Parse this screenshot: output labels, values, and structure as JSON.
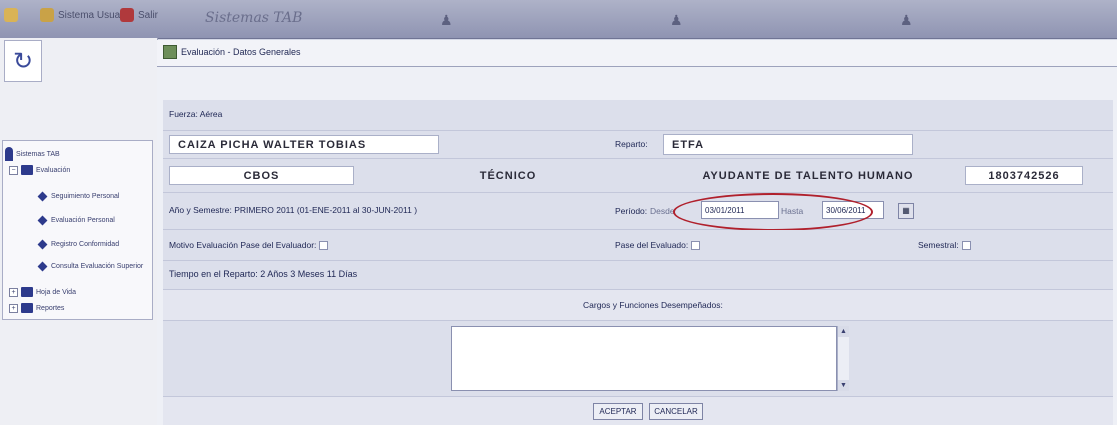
{
  "top_bar": {
    "app_name": "Sistemas TAB",
    "items": [
      {
        "label": "",
        "icon": "home-icon"
      },
      {
        "label": "Sistema Usuario",
        "icon": "user-icon"
      },
      {
        "label": "Salir",
        "icon": "exit-icon"
      }
    ]
  },
  "sidebar": {
    "refresh_icon": "refresh-icon",
    "tree": [
      {
        "label": "Sistemas TAB",
        "icon": "user-icon",
        "level": 0
      },
      {
        "label": "Evaluación",
        "icon": "folder-icon",
        "level": 1
      },
      {
        "label": "Seguimiento Personal",
        "icon": "diamond-icon",
        "level": 2
      },
      {
        "label": "Evaluación Personal",
        "icon": "diamond-icon",
        "level": 2
      },
      {
        "label": "Registro Conformidad",
        "icon": "diamond-icon",
        "level": 2
      },
      {
        "label": "Consulta Evaluación Superior",
        "icon": "diamond-icon",
        "level": 2
      },
      {
        "label": "Hoja de Vida",
        "icon": "folder-icon",
        "level": 1
      },
      {
        "label": "Reportes",
        "icon": "folder-icon",
        "level": 1
      }
    ]
  },
  "tab": {
    "label": "Evaluación - Datos Generales"
  },
  "form": {
    "section_label": "Fuerza: Aérea",
    "name": "CAIZA PICHA WALTER TOBIAS",
    "reparto_label": "Reparto:",
    "reparto_value": "ETFA",
    "grado": "CBOS",
    "especialidad": "TÉCNICO",
    "cargo": "AYUDANTE DE TALENTO HUMANO",
    "cedula": "1803742526",
    "semestre_text": "Año y Semestre: PRIMERO 2011 (01-ENE-2011 al 30-JUN-2011 )",
    "periodo_label": "Período:",
    "desde_label": "Desde",
    "desde_value": "03/01/2011",
    "hasta_label": "Hasta",
    "hasta_value": "30/06/2011",
    "motivo_label": "Motivo Evaluación Pase del Evaluador:",
    "pase_label": "Pase del Evaluado:",
    "semestral_label": "Semestral:",
    "tiempo_text": "Tiempo en el Reparto: 2 Años 3 Meses 11 Días",
    "cargos_label": "Cargos y Funciones Desempeñados:",
    "cargos_value": "",
    "accept_label": "ACEPTAR",
    "cancel_label": "CANCELAR"
  },
  "colors": {
    "accent": "#2d3a8c",
    "highlight_circle": "#b0202c",
    "background": "#d4d8e6"
  }
}
